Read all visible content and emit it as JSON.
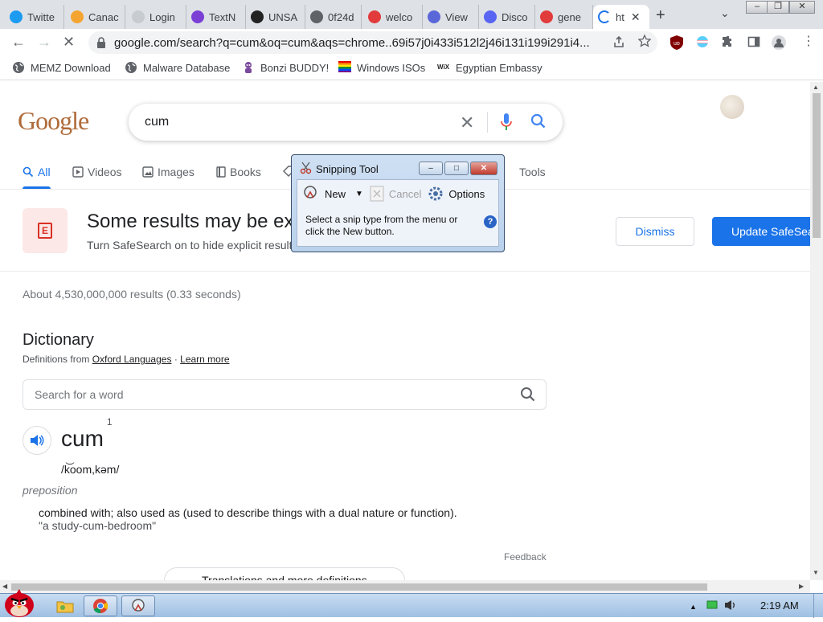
{
  "browser": {
    "tabs": [
      {
        "label": "Twitte",
        "icon": "twitter-icon",
        "color": "#1d9bf0"
      },
      {
        "label": "Canac",
        "icon": "canac-icon",
        "color": "#f4a531"
      },
      {
        "label": "Login",
        "icon": "login-icon",
        "color": "#c7ccd1"
      },
      {
        "label": "TextN",
        "icon": "textnow-icon",
        "color": "#7b3fd6"
      },
      {
        "label": "UNSA",
        "icon": "wix-icon",
        "color": "#222222"
      },
      {
        "label": "0f24d",
        "icon": "globe-icon",
        "color": "#5f6368"
      },
      {
        "label": "welco",
        "icon": "welcome-icon",
        "color": "#e23b3b"
      },
      {
        "label": "View",
        "icon": "at-icon",
        "color": "#5a67d8"
      },
      {
        "label": "Disco",
        "icon": "discord-icon",
        "color": "#5865f2"
      },
      {
        "label": "gene",
        "icon": "gene-icon",
        "color": "#e23b3b"
      },
      {
        "label": "ht",
        "icon": "loading-icon",
        "color": "#1a73e8"
      }
    ],
    "url": "google.com/search?q=cum&oq=cum&aqs=chrome..69i57j0i433i512l2j46i131i199i291i4...",
    "bookmarks": [
      {
        "label": "MEMZ Download",
        "icon": "globe-icon"
      },
      {
        "label": "Malware Database",
        "icon": "globe-icon"
      },
      {
        "label": "Bonzi BUDDY!",
        "icon": "bonzi-icon"
      },
      {
        "label": "Windows ISOs",
        "icon": "windows-flag-icon"
      },
      {
        "label": "Egyptian Embassy",
        "icon": "wix-icon"
      }
    ]
  },
  "search": {
    "logo": "Google",
    "query": "cum",
    "tabs": [
      {
        "label": "All",
        "icon": "⌕"
      },
      {
        "label": "Videos",
        "icon": "▶"
      },
      {
        "label": "Images",
        "icon": "▣"
      },
      {
        "label": "Books",
        "icon": "▮"
      },
      {
        "label": "Tools",
        "icon": ""
      }
    ]
  },
  "safesearch": {
    "title": "Some results may be ex",
    "subtitle": "Turn SafeSearch on to hide explicit result",
    "dismiss": "Dismiss",
    "update": "Update SafeSea",
    "icon_letter": "E"
  },
  "results": {
    "stats": "About 4,530,000,000 results (0.33 seconds)"
  },
  "dictionary": {
    "title": "Dictionary",
    "source_prefix": "Definitions from",
    "source_link": "Oxford Languages",
    "separator": "·",
    "learn_more": "Learn more",
    "search_placeholder": "Search for a word",
    "word": "cum",
    "word_sup": "1",
    "phonetic": "/k͝oom,kəm/",
    "part_of_speech": "preposition",
    "definition": "combined with; also used as (used to describe things with a dual nature or function).",
    "example": "\"a study-cum-bedroom\"",
    "feedback": "Feedback",
    "translations": "Translations and more definitions"
  },
  "snipping_tool": {
    "title": "Snipping Tool",
    "new_label": "New",
    "cancel_label": "Cancel",
    "options_label": "Options",
    "message": "Select a snip type from the menu or click the New button."
  },
  "taskbar": {
    "clock": "2:19 AM"
  }
}
